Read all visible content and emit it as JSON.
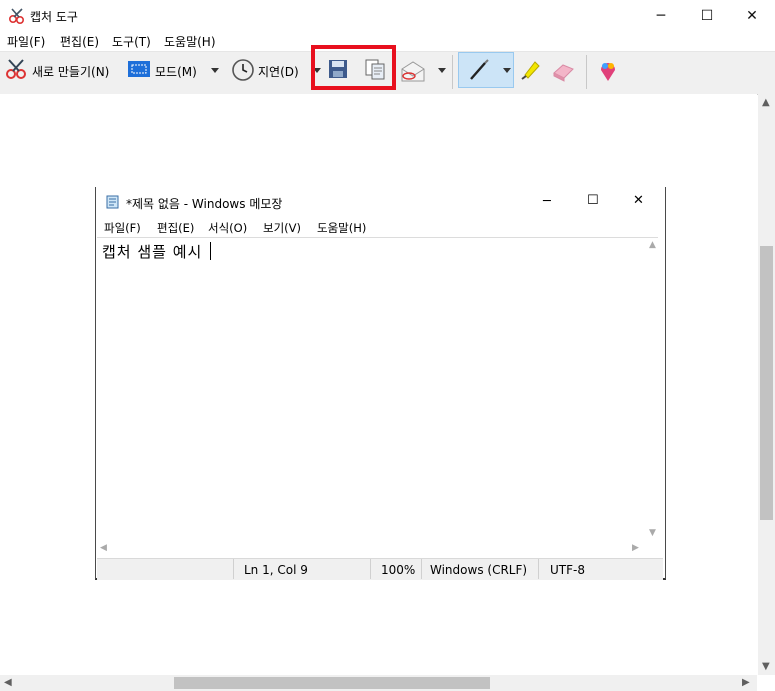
{
  "window": {
    "title": "캡처 도구",
    "minimize_glyph": "─",
    "maximize_glyph": "☐",
    "close_glyph": "✕"
  },
  "menu": [
    "파일(F)",
    "편집(E)",
    "도구(T)",
    "도움말(H)"
  ],
  "toolbar": {
    "new_label": "새로 만들기(N)",
    "mode_label": "모드(M)",
    "delay_label": "지연(D)",
    "icons": [
      "scissors-icon",
      "mode-icon",
      "clock-icon",
      "save-icon",
      "copy-icon",
      "email-icon",
      "pen-icon",
      "highlighter-icon",
      "eraser-icon",
      "paint3d-icon"
    ],
    "highlight_color": "#e8101e",
    "selected_color": "#cce4f7"
  },
  "notepad": {
    "title": "*제목 없음 - Windows 메모장",
    "menu": [
      "파일(F)",
      "편집(E)",
      "서식(O)",
      "보기(V)",
      "도움말(H)"
    ],
    "content": "캡처 샘플 예시",
    "status": {
      "position": "Ln 1, Col 9",
      "zoom": "100%",
      "line_ending": "Windows (CRLF)",
      "encoding": "UTF-8"
    }
  }
}
